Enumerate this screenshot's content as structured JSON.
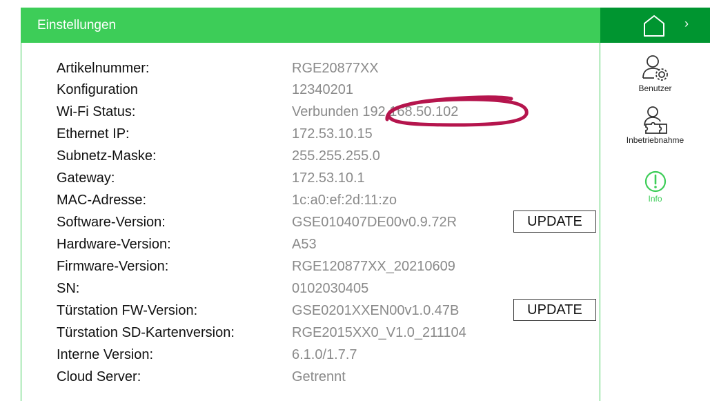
{
  "header": {
    "title": "Einstellungen"
  },
  "info_rows": [
    {
      "label": "Artikelnummer:",
      "value": "RGE20877XX"
    },
    {
      "label": "Konfiguration",
      "value": "12340201"
    },
    {
      "label": "Wi-Fi Status:",
      "value": "Verbunden 192.168.50.102"
    },
    {
      "label": "Ethernet IP:",
      "value": "172.53.10.15"
    },
    {
      "label": "Subnetz-Maske:",
      "value": "255.255.255.0"
    },
    {
      "label": "Gateway:",
      "value": "172.53.10.1"
    },
    {
      "label": "MAC-Adresse:",
      "value": "1c:a0:ef:2d:11:zo"
    },
    {
      "label": "Software-Version:",
      "value": "GSE010407DE00v0.9.72R"
    },
    {
      "label": "Hardware-Version:",
      "value": "A53"
    },
    {
      "label": "Firmware-Version:",
      "value": "RGE120877XX_20210609"
    },
    {
      "label": "SN:",
      "value": "0102030405"
    },
    {
      "label": "Türstation FW-Version:",
      "value": "GSE0201XXEN00v1.0.47B"
    },
    {
      "label": "Türstation SD-Kartenversion:",
      "value": "RGE2015XX0_V1.0_211104"
    },
    {
      "label": "Interne Version:",
      "value": "6.1.0/1.7.7"
    },
    {
      "label": "Cloud Server:",
      "value": "Getrennt"
    }
  ],
  "buttons": {
    "software_update": "UPDATE",
    "doorstation_update": "UPDATE"
  },
  "sidebar": {
    "home_icon": "home-icon",
    "chevron_icon": "chevron-right-icon",
    "items": [
      {
        "label": "Benutzer",
        "icon": "user-gear-icon"
      },
      {
        "label": "Inbetriebnahme",
        "icon": "user-puzzle-icon"
      },
      {
        "label": "Info",
        "icon": "info-icon",
        "active": true
      }
    ]
  },
  "colors": {
    "header_green": "#3dcd58",
    "home_green": "#009530",
    "annotation": "#b5154d",
    "value_gray": "#8a8a8a"
  }
}
